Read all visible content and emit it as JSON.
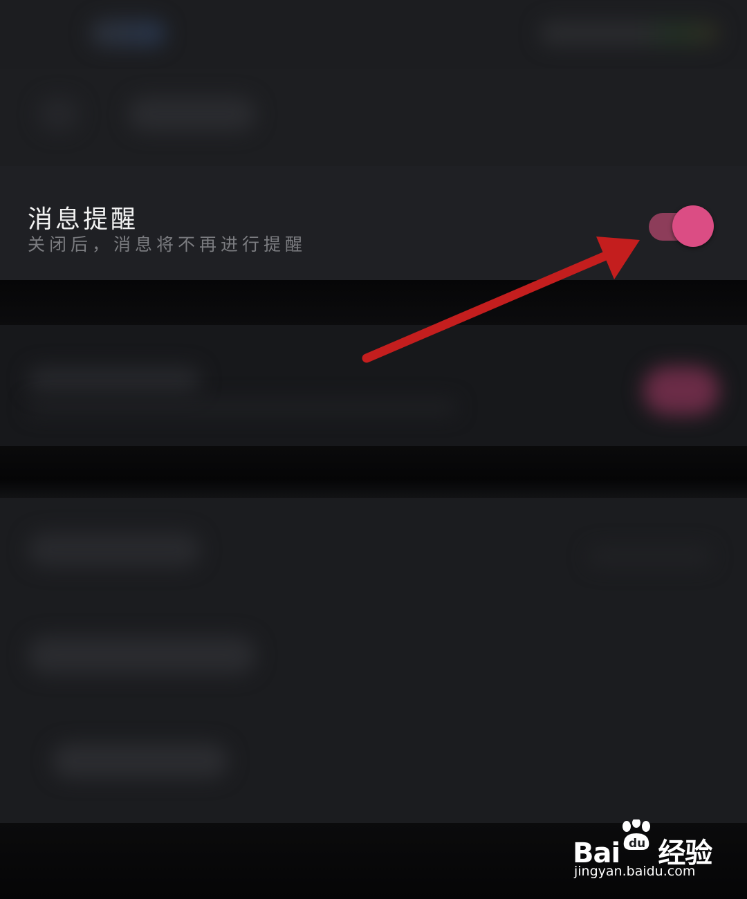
{
  "setting": {
    "title": "消息提醒",
    "subtitle": "关闭后，消息将不再进行提醒",
    "toggle_on": true
  },
  "colors": {
    "toggle_thumb": "#db4d84",
    "toggle_track": "#8d3d5a",
    "annotation_arrow": "#c41e1e"
  },
  "watermark": {
    "brand_left": "Bai",
    "brand_mid": "du",
    "brand_right": "经验",
    "url": "jingyan.baidu.com"
  }
}
